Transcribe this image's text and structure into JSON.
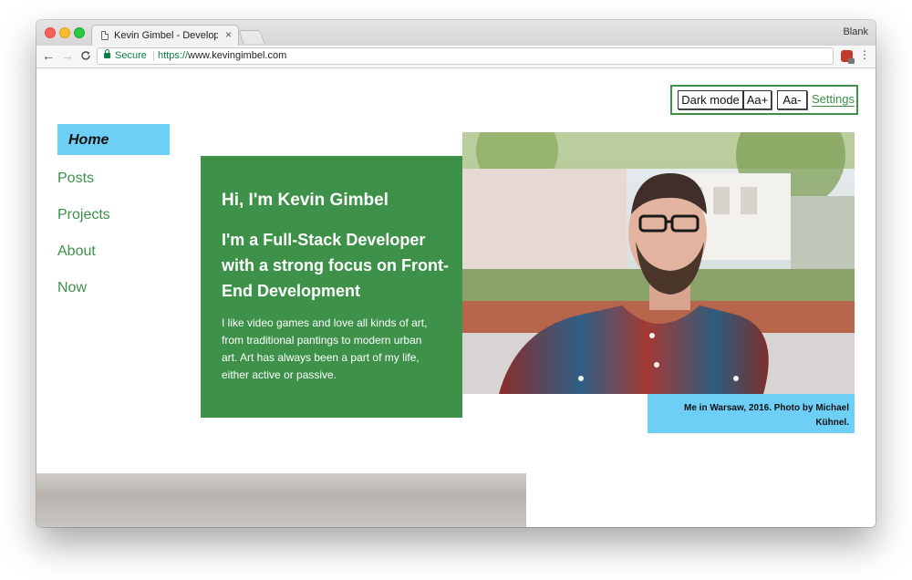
{
  "browser": {
    "tab_title": "Kevin Gimbel - Developer | Kevin Gimbel",
    "tab_close": "×",
    "profile_name": "Blank",
    "secure_label": "Secure",
    "url_scheme": "https://",
    "url_host": "www.kevingimbel.com",
    "nav_back": "←",
    "nav_forward": "→",
    "nav_reload": "C",
    "star": "☆",
    "menu": "⋮"
  },
  "settings": {
    "dark_mode": "Dark mode",
    "font_up": "Aa+",
    "font_down": "Aa-",
    "settings_link": "Settings"
  },
  "sidebar": {
    "items": [
      {
        "label": "Home",
        "active": true
      },
      {
        "label": "Posts"
      },
      {
        "label": "Projects"
      },
      {
        "label": "About"
      },
      {
        "label": "Now"
      }
    ]
  },
  "hero": {
    "greeting": "Hi, I'm Kevin Gimbel",
    "headline": "I'm a Full-Stack Developer with a strong focus on Front-End Development",
    "bio": "I like video games and love all kinds of art, from traditional pantings to modern urban art. Art has always been a part of my life, either active or passive."
  },
  "photo": {
    "caption": "Me in Warsaw, 2016. Photo by Michael Kühnel."
  },
  "colors": {
    "accent_green": "#3d9149",
    "accent_blue": "#6ecff6"
  }
}
